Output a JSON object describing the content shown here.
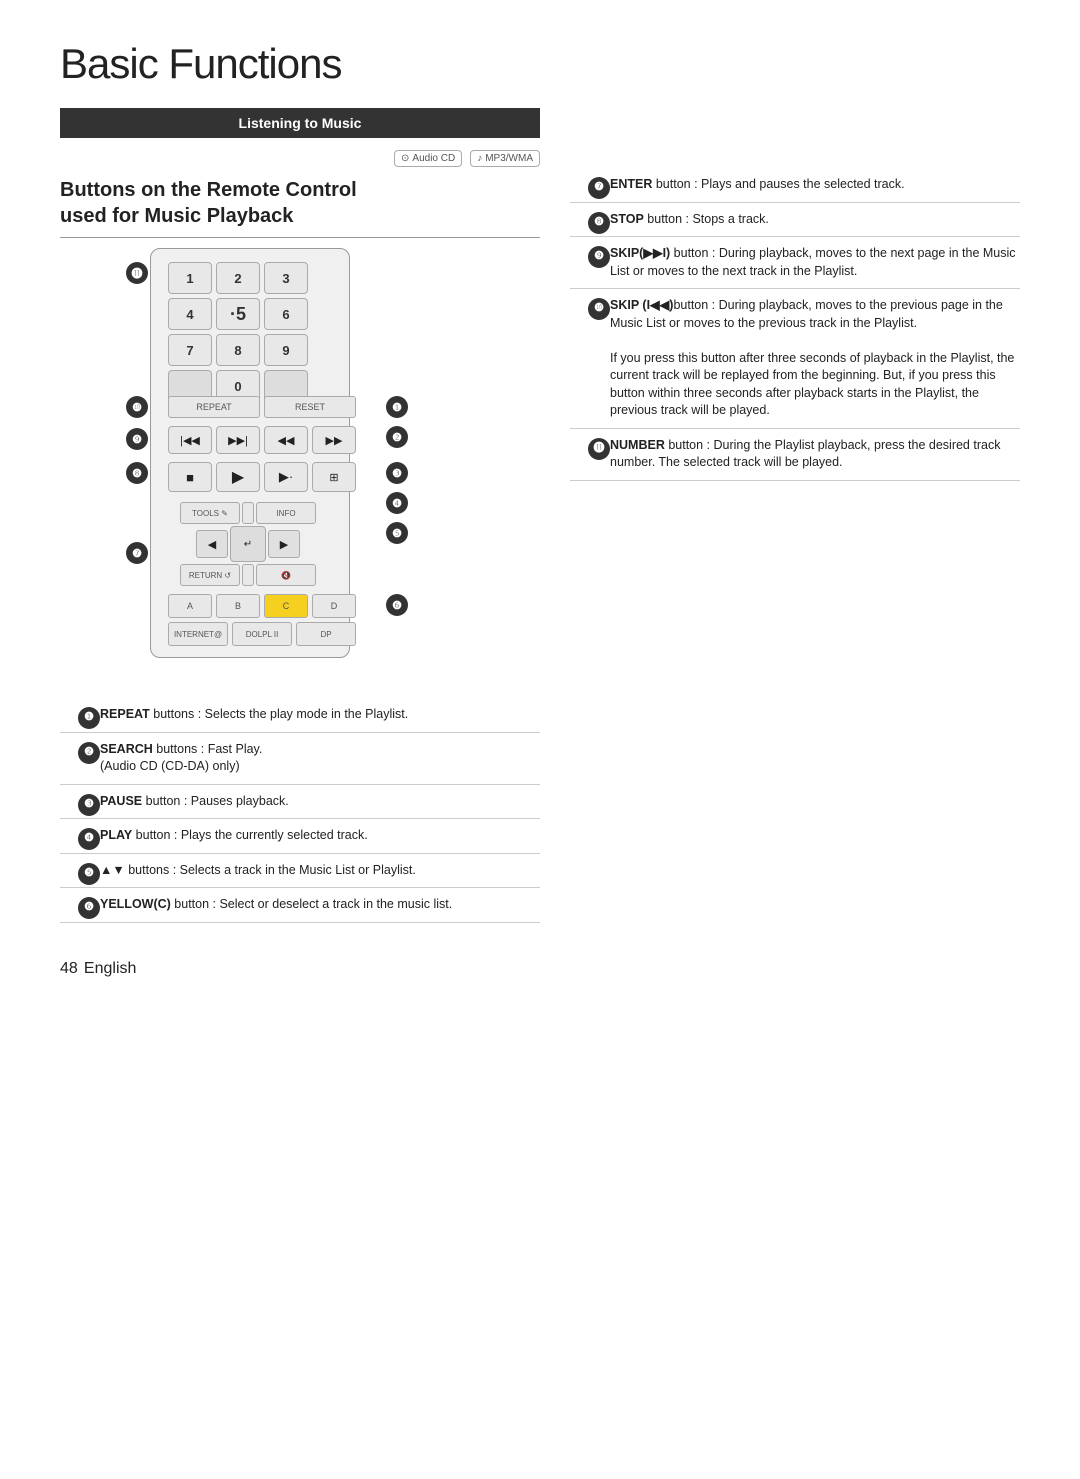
{
  "page": {
    "title": "Basic Functions",
    "page_number": "48",
    "page_label": "English"
  },
  "section": {
    "header": "Listening to Music",
    "heading_line1": "Buttons on the Remote Control",
    "heading_line2": "used for Music Playback"
  },
  "icons": [
    {
      "label": "Audio CD",
      "symbol": "⊙"
    },
    {
      "label": "MP3/WMA",
      "symbol": "♪"
    }
  ],
  "numpad": [
    "1",
    "2",
    "3",
    "4",
    "·5",
    "6",
    "7",
    "8",
    "9",
    "",
    "0",
    ""
  ],
  "callouts_left": [
    {
      "num": "❶",
      "style": "dark",
      "label": "1"
    },
    {
      "num": "❷",
      "style": "dark",
      "label": "2"
    },
    {
      "num": "❸",
      "style": "dark",
      "label": "3"
    },
    {
      "num": "❹",
      "style": "dark",
      "label": "4"
    },
    {
      "num": "❺",
      "style": "dark",
      "label": "5"
    },
    {
      "num": "❻",
      "style": "dark",
      "label": "6"
    },
    {
      "num": "❼",
      "style": "dark",
      "label": "7"
    },
    {
      "num": "❽",
      "style": "dark",
      "label": "8"
    },
    {
      "num": "❾",
      "style": "dark",
      "label": "9"
    },
    {
      "num": "❿",
      "style": "dark",
      "label": "10"
    },
    {
      "num": "⓫",
      "style": "dark",
      "label": "11"
    }
  ],
  "descriptions_left": [
    {
      "num": "❶",
      "key": "REPEAT",
      "text": "buttons : Selects the play mode in the Playlist."
    },
    {
      "num": "❷",
      "key": "SEARCH",
      "text": "buttons : Fast Play.\n(Audio CD (CD-DA) only)"
    },
    {
      "num": "❸",
      "key": "PAUSE",
      "text": "button : Pauses playback."
    },
    {
      "num": "❹",
      "key": "PLAY",
      "text": "button : Plays the currently selected track."
    },
    {
      "num": "❺",
      "key": "▲▼",
      "text": "buttons : Selects a track in the Music List or Playlist."
    },
    {
      "num": "❻",
      "key": "YELLOW(C)",
      "text": "button : Select or deselect a track in the music list."
    }
  ],
  "descriptions_right": [
    {
      "num": "❼",
      "key": "ENTER",
      "text": "button : Plays and pauses the selected track."
    },
    {
      "num": "❽",
      "key": "STOP",
      "text": "button : Stops a track."
    },
    {
      "num": "❾",
      "key": "SKIP(▶▶I)",
      "text": "button : During playback, moves to the next page in the Music List or moves to the next track in the Playlist."
    },
    {
      "num": "❿",
      "key": "SKIP (I◀◀)",
      "text": "button : During playback, moves to the previous page in the Music List or moves to the previous track in the Playlist.\nIf you press this button after three seconds of playback in the Playlist, the current track will be replayed from the beginning. But, if you press this button within three seconds after playback starts in the Playlist, the previous track will be played."
    },
    {
      "num": "⓫",
      "key": "NUMBER",
      "text": "button : During the Playlist playback, press the desired track number. The selected track will be played."
    }
  ]
}
